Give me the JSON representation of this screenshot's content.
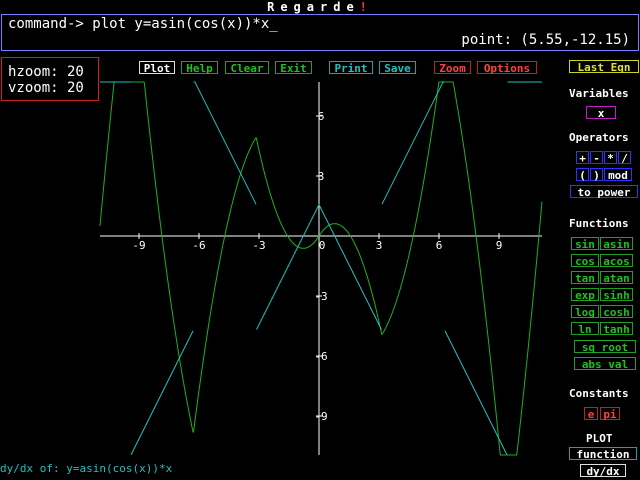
{
  "app": {
    "title": "Regarde",
    "title_mark": "!"
  },
  "command": {
    "prompt": "command-> plot y=asin(cos(x))*x_",
    "point": "point: (5.55,-12.15)"
  },
  "zoom": {
    "h": "hzoom: 20",
    "v": "vzoom: 20"
  },
  "toolbar": {
    "plot": "Plot",
    "help": "Help",
    "clear": "Clear",
    "exit": "Exit",
    "print": "Print",
    "save": "Save",
    "zoom": "Zoom",
    "options": "Options"
  },
  "side": {
    "last_eqn": "Last Eqn",
    "variables_title": "Variables",
    "variable_x": "x",
    "operators_title": "Operators",
    "ops": [
      "+",
      "-",
      "*",
      "/"
    ],
    "parens": [
      "(",
      ")"
    ],
    "mod": "mod",
    "to_power": "to power",
    "functions_title": "Functions",
    "functions": [
      [
        "sin",
        "asin"
      ],
      [
        "cos",
        "acos"
      ],
      [
        "tan",
        "atan"
      ],
      [
        "exp",
        "sinh"
      ],
      [
        "log",
        "cosh"
      ],
      [
        "ln",
        "tanh"
      ]
    ],
    "sq_root": "sq root",
    "abs_val": "abs val",
    "constants_title": "Constants",
    "const_e": "e",
    "const_pi": "pi",
    "plot_title": "PLOT",
    "plot_function": "function",
    "plot_dydx": "dy/dx"
  },
  "footer": "dy/dx of: y=asin(cos(x))*x",
  "graph": {
    "x_ticks": [
      "-9",
      "-6",
      "-3",
      "0",
      "3",
      "6",
      "9"
    ],
    "y_ticks": [
      "6",
      "3",
      "-3",
      "-6",
      "-9"
    ],
    "xlim": [
      -11,
      11
    ],
    "ylim": [
      -11,
      8
    ]
  },
  "colors": {
    "function": "#20b020",
    "derivative": "#20c0c0",
    "axis": "#ffffff"
  }
}
